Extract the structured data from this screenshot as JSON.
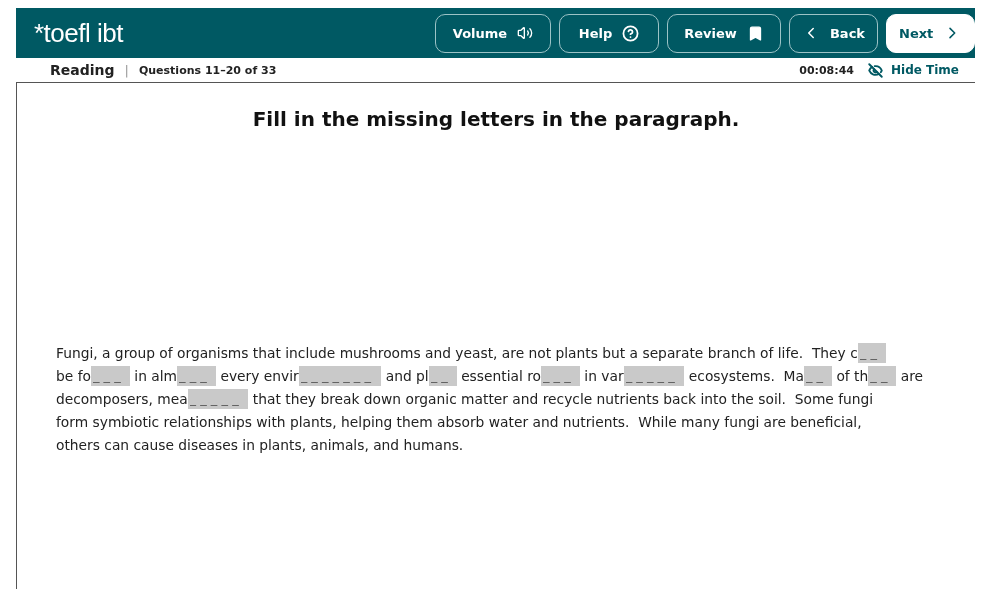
{
  "header": {
    "logo": "*toefl ibt",
    "buttons": [
      {
        "label": "Volume",
        "primary": false
      },
      {
        "label": "Help",
        "primary": false
      },
      {
        "label": "Review",
        "primary": false
      },
      {
        "label": "Back",
        "primary": false
      },
      {
        "label": "Next",
        "primary": true
      }
    ]
  },
  "status_bar": {
    "section": "Reading",
    "separator": "|",
    "progress": "Questions 11–20 of 33",
    "timer": "00:08:44",
    "hide_time": "Hide Time"
  },
  "instruction": "Fill in the missing letters in the paragraph.",
  "passage": [
    [
      {
        "kind": "text",
        "text": "Fungi, a group of organisms that include mushrooms and yeast, are not plants but a separate branch of life.  They c"
      },
      {
        "kind": "blank",
        "placeholder": "_ _"
      }
    ],
    [
      {
        "kind": "text",
        "text": "be fo"
      },
      {
        "kind": "blank",
        "placeholder": "_ _ _"
      },
      {
        "kind": "text",
        "text": " in alm"
      },
      {
        "kind": "blank",
        "placeholder": "_ _ _"
      },
      {
        "kind": "text",
        "text": " every envir"
      },
      {
        "kind": "blank",
        "placeholder": "_ _ _ _ _ _ _"
      },
      {
        "kind": "text",
        "text": " and pl"
      },
      {
        "kind": "blank",
        "placeholder": "_ _"
      },
      {
        "kind": "text",
        "text": " essential ro"
      },
      {
        "kind": "blank",
        "placeholder": "_ _ _"
      },
      {
        "kind": "text",
        "text": " in var"
      },
      {
        "kind": "blank",
        "placeholder": "_ _ _ _ _"
      },
      {
        "kind": "text",
        "text": " ecosystems.  Ma"
      },
      {
        "kind": "blank",
        "placeholder": "_ _"
      },
      {
        "kind": "text",
        "text": " of th"
      },
      {
        "kind": "blank",
        "placeholder": "_ _"
      },
      {
        "kind": "text",
        "text": " are"
      }
    ],
    [
      {
        "kind": "text",
        "text": "decomposers, mea"
      },
      {
        "kind": "blank",
        "placeholder": "_ _ _ _ _"
      },
      {
        "kind": "text",
        "text": " that they break down organic matter and recycle nutrients back into the soil.  Some fungi"
      }
    ],
    [
      {
        "kind": "text",
        "text": "form symbiotic relationships with plants, helping them absorb water and nutrients.  While many fungi are beneficial,"
      }
    ],
    [
      {
        "kind": "text",
        "text": "others can cause diseases in plants, animals, and humans."
      }
    ]
  ]
}
